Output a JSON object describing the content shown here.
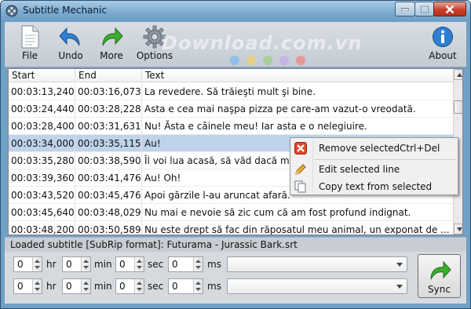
{
  "window": {
    "title": "Subtitle Mechanic"
  },
  "toolbar": {
    "file_label": "File",
    "undo_label": "Undo",
    "more_label": "More",
    "options_label": "Options",
    "about_label": "About",
    "watermark": "Download.com.vn"
  },
  "list": {
    "columns": [
      "Start",
      "End",
      "Text"
    ],
    "rows": [
      {
        "start": "00:03:13,240",
        "end": "00:03:16,073",
        "text": "La revedere. Să trăieşti mult şi bine."
      },
      {
        "start": "00:03:24,440",
        "end": "00:03:28,228",
        "text": "Asta e cea mai naşpa pizza pe care-am vazut-o vreodată."
      },
      {
        "start": "00:03:28,400",
        "end": "00:03:31,631",
        "text": "Nu! Ăsta e câinele meu! Iar asta e o nelegiuire."
      },
      {
        "start": "00:03:34,000",
        "end": "00:03:35,115",
        "text": "Au!"
      },
      {
        "start": "00:03:35,280",
        "end": "00:03:38,590",
        "text": "Îl voi lua acasă, să văd dacă mi"
      },
      {
        "start": "00:03:39,360",
        "end": "00:03:41,476",
        "text": "Au! Oh!"
      },
      {
        "start": "00:03:43,520",
        "end": "00:03:45,476",
        "text": "Apoi gărzile l-au aruncat afară."
      },
      {
        "start": "00:03:45,640",
        "end": "00:03:48,029",
        "text": "Nu mai e nevoie să zic cum că am fost profund indignat."
      },
      {
        "start": "00:03:48,200",
        "end": "00:03:50,589",
        "text": "Nu este drept să fac din răposatul meu animal, un exponat de ..."
      }
    ],
    "selected_index": 3
  },
  "context_menu": {
    "remove_label": "Remove selected",
    "remove_shortcut": "Ctrl+Del",
    "edit_label": "Edit selected line",
    "copy_label": "Copy text from selected"
  },
  "status": {
    "text": "Loaded subtitle [SubRip format]: Futurama - Jurassic Bark.srt"
  },
  "time_inputs": {
    "row1": {
      "hr": "0",
      "min": "0",
      "sec": "0",
      "ms": "0"
    },
    "row2": {
      "hr": "0",
      "min": "0",
      "sec": "0",
      "ms": "0"
    },
    "hr_label": "hr",
    "min_label": "min",
    "sec_label": "sec",
    "ms_label": "ms"
  },
  "sync_label": "Sync",
  "colors": {
    "selection": "#bfd3ea",
    "accent_blue": "#2f7fd1",
    "accent_green": "#3cae2f"
  }
}
